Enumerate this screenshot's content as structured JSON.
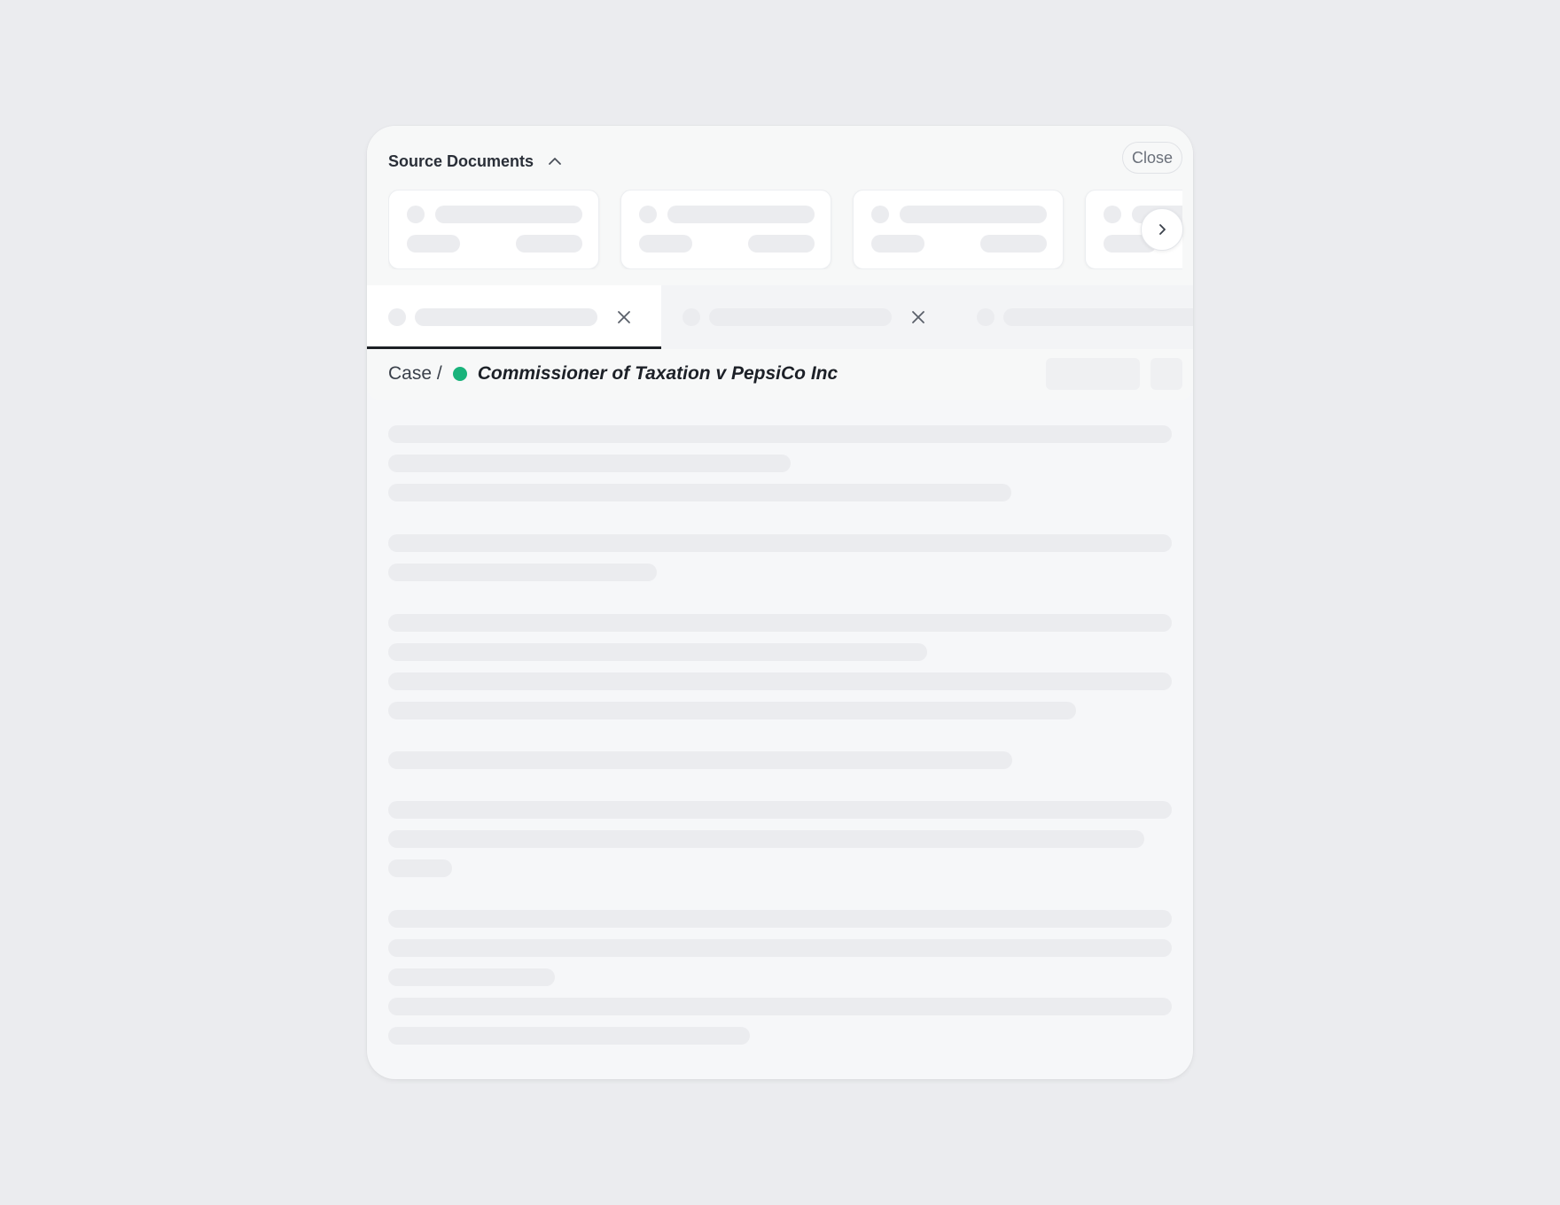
{
  "source_documents": {
    "title": "Source Documents",
    "close_label": "Close",
    "toggle_icon": "chevron-up-icon",
    "next_icon": "chevron-right-icon"
  },
  "tabs": {
    "close_icon": "close-icon"
  },
  "breadcrumb": {
    "prefix": "Case /",
    "case_name": "Commissioner of Taxation v PepsiCo Inc",
    "status_color": "#19b37b"
  },
  "colors": {
    "background": "#ebecef",
    "panel": "#f6f7f9",
    "skeleton": "#ebecef",
    "active_tab_underline": "#1d2025"
  }
}
